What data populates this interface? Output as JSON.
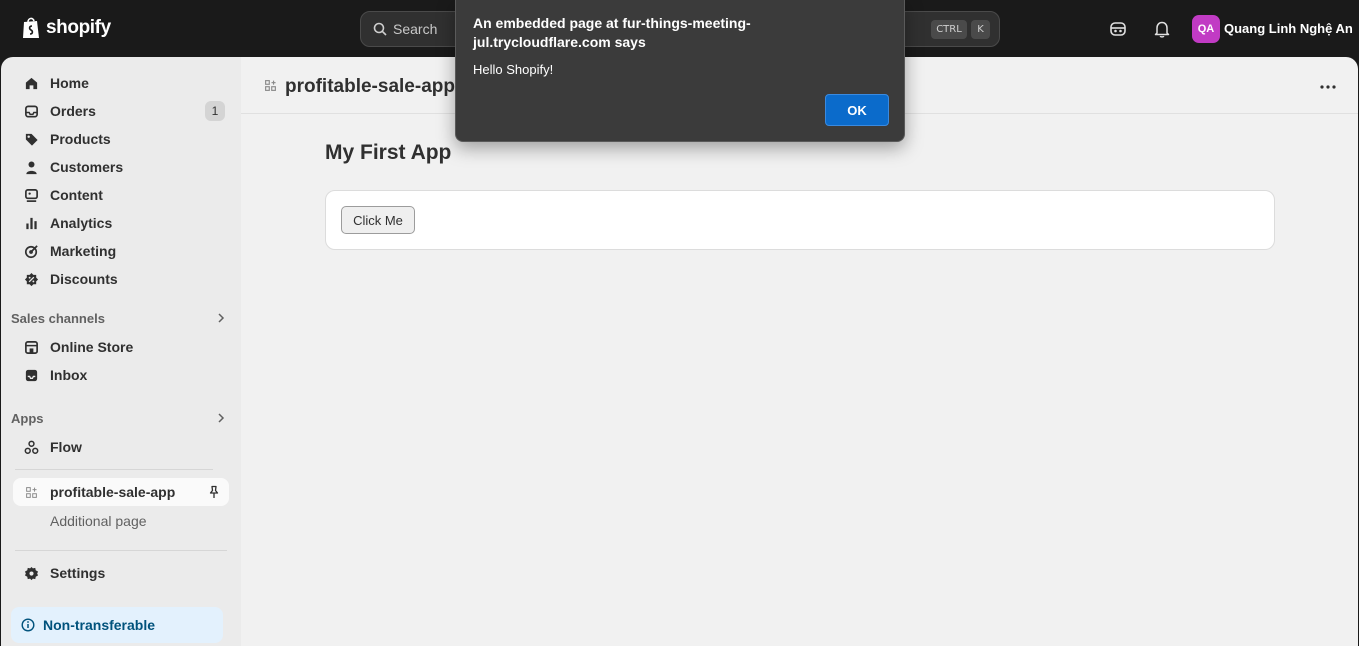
{
  "topbar": {
    "brand": "shopify",
    "search_placeholder": "Search",
    "shortcut_ctrl": "CTRL",
    "shortcut_k": "K",
    "avatar_initials": "QA",
    "user_name": "Quang Linh Nghệ An",
    "avatar_color": "#c13bc4"
  },
  "sidebar": {
    "items": [
      {
        "label": "Home",
        "icon": "home-icon"
      },
      {
        "label": "Orders",
        "icon": "inbox-tray-icon",
        "badge": "1"
      },
      {
        "label": "Products",
        "icon": "tag-icon"
      },
      {
        "label": "Customers",
        "icon": "person-icon"
      },
      {
        "label": "Content",
        "icon": "image-text-icon"
      },
      {
        "label": "Analytics",
        "icon": "bar-chart-icon"
      },
      {
        "label": "Marketing",
        "icon": "target-icon"
      },
      {
        "label": "Discounts",
        "icon": "discount-badge-icon"
      }
    ],
    "sales_channels": {
      "label": "Sales channels",
      "items": [
        {
          "label": "Online Store",
          "icon": "storefront-icon"
        },
        {
          "label": "Inbox",
          "icon": "inbox-icon"
        }
      ]
    },
    "apps": {
      "label": "Apps",
      "items": [
        {
          "label": "Flow",
          "icon": "flow-icon"
        },
        {
          "label": "profitable-sale-app",
          "icon": "app-grid-icon"
        }
      ],
      "sub_item": "Additional page"
    },
    "settings": "Settings",
    "non_transferable": "Non-transferable"
  },
  "main": {
    "app_title": "profitable-sale-app",
    "page_heading": "My First App",
    "button_label": "Click Me"
  },
  "dialog": {
    "title": "An embedded page at fur-things-meeting-jul.trycloudflare.com says",
    "message": "Hello Shopify!",
    "ok_label": "OK",
    "ok_color": "#0b6bcb"
  }
}
